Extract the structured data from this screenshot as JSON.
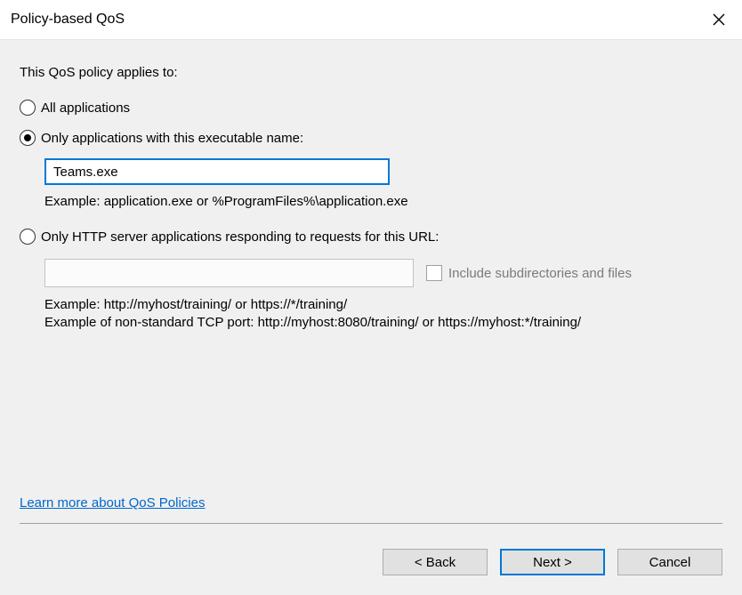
{
  "window": {
    "title": "Policy-based QoS"
  },
  "form": {
    "heading": "This QoS policy applies to:",
    "radio_all_label": "All applications",
    "radio_exe_label": "Only applications with this executable name:",
    "exe_value": "Teams.exe",
    "exe_example": "Example:  application.exe or %ProgramFiles%\\application.exe",
    "radio_http_label": "Only HTTP server applications responding to requests for this URL:",
    "include_subdirs_label": "Include subdirectories and files",
    "http_example1": "Example:  http://myhost/training/ or https://*/training/",
    "http_example2": "Example of non-standard TCP port:  http://myhost:8080/training/ or https://myhost:*/training/",
    "learn_more": "Learn more about QoS Policies"
  },
  "buttons": {
    "back": "< Back",
    "next": "Next >",
    "cancel": "Cancel"
  }
}
